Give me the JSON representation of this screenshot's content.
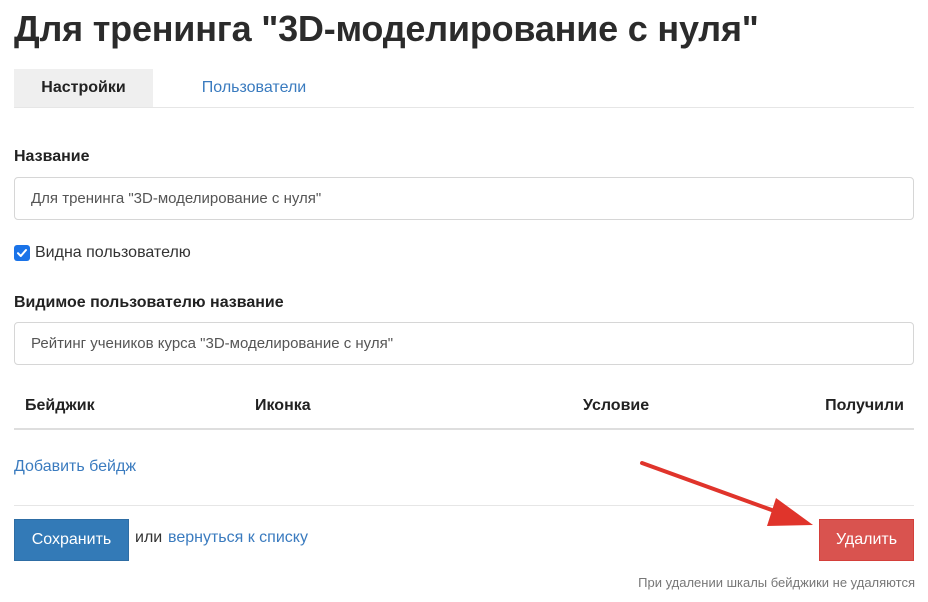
{
  "page": {
    "title": "Для тренинга \"3D-моделирование с нуля\""
  },
  "tabs": {
    "settings": "Настройки",
    "users": "Пользователи"
  },
  "form": {
    "name_label": "Название",
    "name_value": "Для тренинга \"3D-моделирование с нуля\"",
    "visible_label": "Видна пользователю",
    "visible_checked": true,
    "visible_name_label": "Видимое пользователю название",
    "visible_name_value": "Рейтинг учеников курса \"3D-моделирование с нуля\""
  },
  "table": {
    "columns": [
      "Бейджик",
      "Иконка",
      "Условие",
      "Получили"
    ]
  },
  "actions": {
    "add_badge": "Добавить бейдж",
    "save": "Сохранить",
    "or": "или",
    "back": "вернуться к списку",
    "delete": "Удалить",
    "hint": "При удалении шкалы бейджики не удаляются"
  },
  "colors": {
    "primary": "#337ab7",
    "danger": "#d9534f",
    "link": "#3a7bbf",
    "arrow": "#e0342b"
  }
}
